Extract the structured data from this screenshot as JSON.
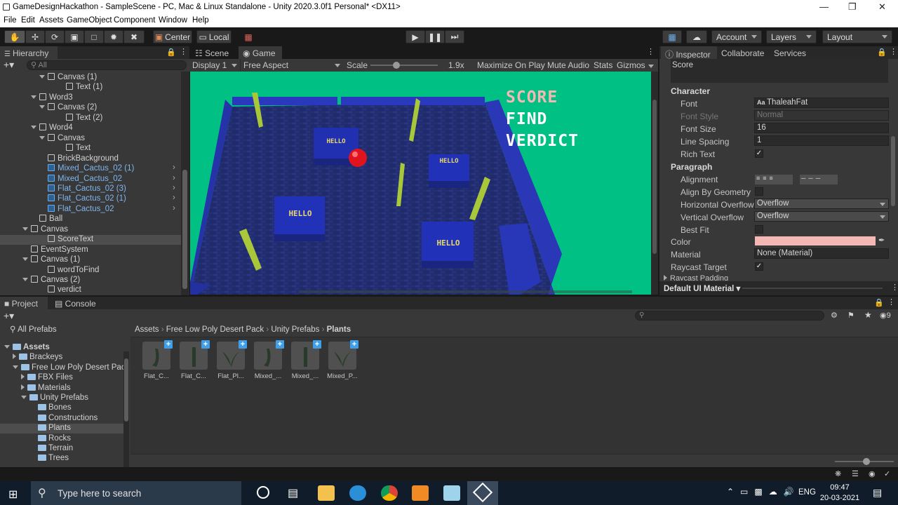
{
  "window": {
    "title": "GameDesignHackathon - SampleScene - PC, Mac & Linux Standalone - Unity 2020.3.0f1 Personal* <DX11>"
  },
  "menu": [
    "File",
    "Edit",
    "Assets",
    "GameObject",
    "Component",
    "Window",
    "Help"
  ],
  "toolbar": {
    "center": "Center",
    "local": "Local",
    "account": "Account",
    "layers": "Layers",
    "layout": "Layout"
  },
  "hierarchy": {
    "tab": "Hierarchy",
    "search": "All",
    "items": [
      {
        "label": "Canvas (1)",
        "indent": 68,
        "arrow": "down",
        "blue": false
      },
      {
        "label": "Text (1)",
        "indent": 94,
        "arrow": "",
        "blue": false
      },
      {
        "label": "Word3",
        "indent": 56,
        "arrow": "down",
        "blue": false
      },
      {
        "label": "Canvas (2)",
        "indent": 68,
        "arrow": "down",
        "blue": false
      },
      {
        "label": "Text (2)",
        "indent": 94,
        "arrow": "",
        "blue": false
      },
      {
        "label": "Word4",
        "indent": 56,
        "arrow": "down",
        "blue": false
      },
      {
        "label": "Canvas",
        "indent": 68,
        "arrow": "down",
        "blue": false
      },
      {
        "label": "Text",
        "indent": 94,
        "arrow": "",
        "blue": false
      },
      {
        "label": "BrickBackground",
        "indent": 68,
        "arrow": "",
        "blue": false
      },
      {
        "label": "Mixed_Cactus_02 (1)",
        "indent": 68,
        "arrow": "",
        "blue": true
      },
      {
        "label": "Mixed_Cactus_02",
        "indent": 68,
        "arrow": "",
        "blue": true
      },
      {
        "label": "Flat_Cactus_02 (3)",
        "indent": 68,
        "arrow": "",
        "blue": true
      },
      {
        "label": "Flat_Cactus_02 (1)",
        "indent": 68,
        "arrow": "",
        "blue": true
      },
      {
        "label": "Flat_Cactus_02",
        "indent": 68,
        "arrow": "",
        "blue": true
      },
      {
        "label": "Ball",
        "indent": 56,
        "arrow": "",
        "blue": false
      },
      {
        "label": "Canvas",
        "indent": 44,
        "arrow": "down",
        "blue": false
      },
      {
        "label": "ScoreText",
        "indent": 68,
        "arrow": "",
        "blue": false
      },
      {
        "label": "EventSystem",
        "indent": 44,
        "arrow": "",
        "blue": false
      },
      {
        "label": "Canvas (1)",
        "indent": 44,
        "arrow": "down",
        "blue": false
      },
      {
        "label": "wordToFind",
        "indent": 68,
        "arrow": "",
        "blue": false
      },
      {
        "label": "Canvas (2)",
        "indent": 44,
        "arrow": "down",
        "blue": false
      },
      {
        "label": "verdict",
        "indent": 68,
        "arrow": "",
        "blue": false
      }
    ]
  },
  "game": {
    "tab_scene": "Scene",
    "tab_game": "Game",
    "display": "Display 1",
    "aspect": "Free Aspect",
    "scale_label": "Scale",
    "scale_value": "1.9x",
    "maximize": "Maximize On Play",
    "mute": "Mute Audio",
    "stats": "Stats",
    "gizmos": "Gizmos",
    "overlay": [
      "SCORE",
      "FIND",
      "VERDICT"
    ],
    "tiles": [
      "HELLO",
      "HELLO",
      "HELLO",
      "HELLO"
    ]
  },
  "inspector": {
    "tab": "Inspector",
    "collab": "Collaborate",
    "services": "Services",
    "text_value": "Score",
    "character": "Character",
    "font_label": "Font",
    "font_value": "ThaleahFat",
    "font_style_label": "Font Style",
    "font_style_value": "Normal",
    "font_size_label": "Font Size",
    "font_size_value": "16",
    "line_spacing_label": "Line Spacing",
    "line_spacing_value": "1",
    "rich_text_label": "Rich Text",
    "paragraph": "Paragraph",
    "alignment_label": "Alignment",
    "align_geom_label": "Align By Geometry",
    "h_overflow_label": "Horizontal Overflow",
    "h_overflow_value": "Overflow",
    "v_overflow_label": "Vertical Overflow",
    "v_overflow_value": "Overflow",
    "best_fit_label": "Best Fit",
    "color_label": "Color",
    "color_value": "#f4b8b4",
    "material_label": "Material",
    "material_value": "None (Material)",
    "raycast_label": "Raycast Target",
    "raycast_padding": "Raycast Padding",
    "default_material": "Default UI Material"
  },
  "project": {
    "tab_project": "Project",
    "tab_console": "Console",
    "all_prefabs": "All Prefabs",
    "breadcrumb": [
      "Assets",
      "Free Low Poly Desert Pack",
      "Unity Prefabs",
      "Plants"
    ],
    "tree": [
      {
        "label": "Assets",
        "indent": 6,
        "arrow": "down",
        "bold": true
      },
      {
        "label": "Brackeys",
        "indent": 18,
        "arrow": "right",
        "bold": false
      },
      {
        "label": "Free Low Poly Desert Pack",
        "indent": 18,
        "arrow": "down",
        "bold": false
      },
      {
        "label": "FBX Files",
        "indent": 30,
        "arrow": "right",
        "bold": false
      },
      {
        "label": "Materials",
        "indent": 30,
        "arrow": "right",
        "bold": false
      },
      {
        "label": "Unity Prefabs",
        "indent": 30,
        "arrow": "down",
        "bold": false
      },
      {
        "label": "Bones",
        "indent": 42,
        "arrow": "",
        "bold": false
      },
      {
        "label": "Constructions",
        "indent": 42,
        "arrow": "",
        "bold": false
      },
      {
        "label": "Plants",
        "indent": 42,
        "arrow": "",
        "bold": false
      },
      {
        "label": "Rocks",
        "indent": 42,
        "arrow": "",
        "bold": false
      },
      {
        "label": "Terrain",
        "indent": 42,
        "arrow": "",
        "bold": false
      },
      {
        "label": "Trees",
        "indent": 42,
        "arrow": "",
        "bold": false
      }
    ],
    "assets": [
      "Flat_C...",
      "Flat_C...",
      "Flat_Pl...",
      "Mixed_...",
      "Mixed_...",
      "Mixed_P..."
    ],
    "hidden_count": "9"
  },
  "taskbar": {
    "search": "Type here to search",
    "lang": "ENG",
    "time": "09:47",
    "date": "20-03-2021"
  }
}
